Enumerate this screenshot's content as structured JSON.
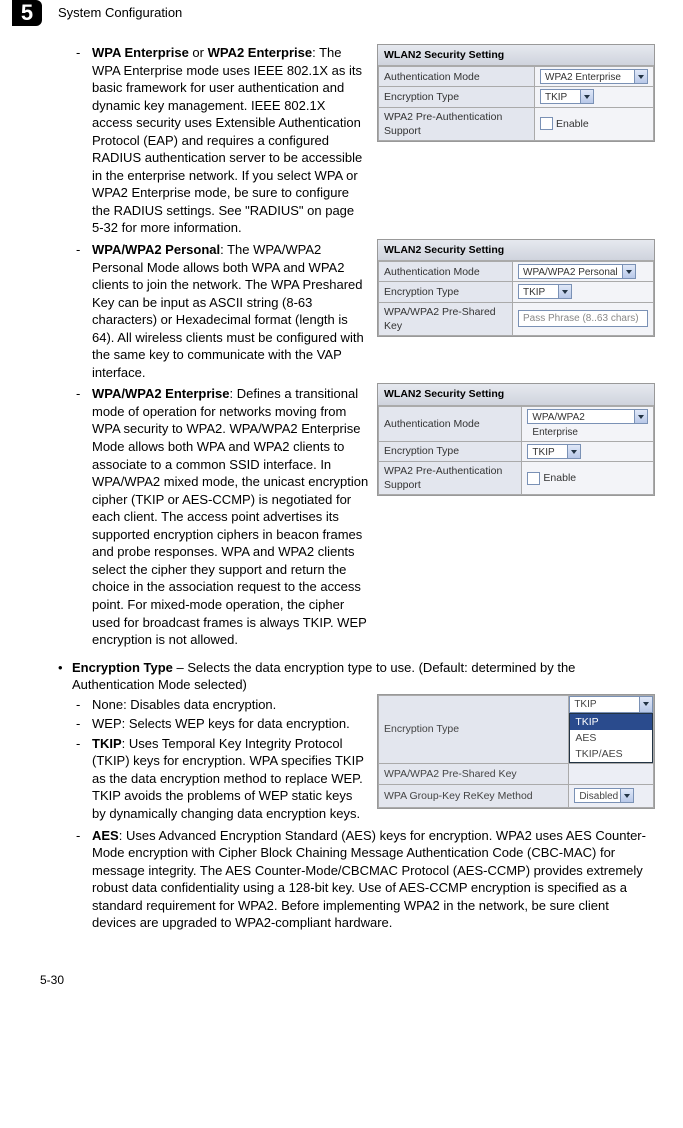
{
  "header": {
    "chapter_number": "5",
    "title": "System Configuration"
  },
  "panels": {
    "p1": {
      "title": "WLAN2 Security Setting",
      "r1_label": "Authentication Mode",
      "r1_value": "WPA2 Enterprise",
      "r2_label": "Encryption Type",
      "r2_value": "TKIP",
      "r3_label": "WPA2 Pre-Authentication Support",
      "r3_value": "Enable"
    },
    "p2": {
      "title": "WLAN2 Security Setting",
      "r1_label": "Authentication Mode",
      "r1_value": "WPA/WPA2 Personal",
      "r2_label": "Encryption Type",
      "r2_value": "TKIP",
      "r3_label": "WPA/WPA2 Pre-Shared Key",
      "r3_value": "Pass Phrase (8..63 chars)"
    },
    "p3": {
      "title": "WLAN2 Security Setting",
      "r1_label": "Authentication Mode",
      "r1_value": "WPA/WPA2 Enterprise",
      "r2_label": "Encryption Type",
      "r2_value": "TKIP",
      "r3_label": "WPA2 Pre-Authentication Support",
      "r3_value": "Enable"
    },
    "p4": {
      "r1_label": "Encryption Type",
      "r1_value": "TKIP",
      "r2_label": "WPA/WPA2 Pre-Shared Key",
      "r3_label": "WPA Group-Key ReKey Method",
      "r3_value": "Disabled",
      "opts": {
        "o1": "TKIP",
        "o2": "AES",
        "o3": "TKIP/AES"
      }
    }
  },
  "body": {
    "wpa_ent_label": "WPA Enterprise",
    "or": " or ",
    "wpa2_ent_label": "WPA2 Enterprise",
    "wpa_ent_text": ": The WPA Enterprise mode uses IEEE 802.1X as its basic framework for user authentication and dynamic key management. IEEE 802.1X access security uses Extensible Authentication Protocol (EAP) and requires a configured RADIUS authentication server to be accessible in the enterprise network. If you select WPA or WPA2 Enterprise mode, be sure to configure the RADIUS settings. See \"RADIUS\" on page 5-32 for more information.",
    "wpa_pers_label": "WPA/WPA2 Personal",
    "wpa_pers_text": ": The WPA/WPA2 Personal Mode allows both WPA and WPA2 clients to join the network. The WPA Preshared Key can be input as ASCII string (8-63 characters) or Hexadecimal format (length is 64). All wireless clients must be configured with the same key to communicate with the VAP interface.",
    "wpa_mix_label": "WPA/WPA2 Enterprise",
    "wpa_mix_text": ": Defines a transitional mode of operation for networks moving from WPA security to WPA2. WPA/WPA2 Enterprise Mode allows both WPA and WPA2 clients to associate to a common SSID interface. In WPA/WPA2 mixed mode, the unicast encryption cipher (TKIP or AES-CCMP) is negotiated for each client. The access point advertises its supported encryption ciphers in beacon frames and probe responses. WPA and WPA2 clients select the cipher they support and return the choice in the association request to the access point. For mixed-mode operation, the cipher used for broadcast frames is always TKIP. WEP encryption is not allowed.",
    "enc_label": "Encryption Type",
    "enc_text": " – Selects the data encryption type to use. (Default: determined by the Authentication Mode selected)",
    "none_text": "None: Disables data encryption.",
    "wep_text": "WEP: Selects WEP keys for data encryption.",
    "tkip_label": "TKIP",
    "tkip_text": ": Uses Temporal Key Integrity Protocol (TKIP) keys for encryption. WPA specifies TKIP as the data encryption method to replace WEP. TKIP avoids the problems of WEP static keys by dynamically changing data encryption keys.",
    "aes_label": "AES",
    "aes_text": ": Uses Advanced Encryption Standard (AES) keys for encryption. WPA2 uses AES Counter-Mode encryption with Cipher Block Chaining Message Authentication Code (CBC-MAC) for message integrity. The AES Counter-Mode/CBCMAC Protocol (AES-CCMP) provides extremely robust data confidentiality using a 128-bit key. Use of AES-CCMP encryption is specified as a standard requirement for WPA2. Before implementing WPA2 in the network, be sure client devices are upgraded to WPA2-compliant hardware."
  },
  "footer": {
    "page": "5-30"
  }
}
